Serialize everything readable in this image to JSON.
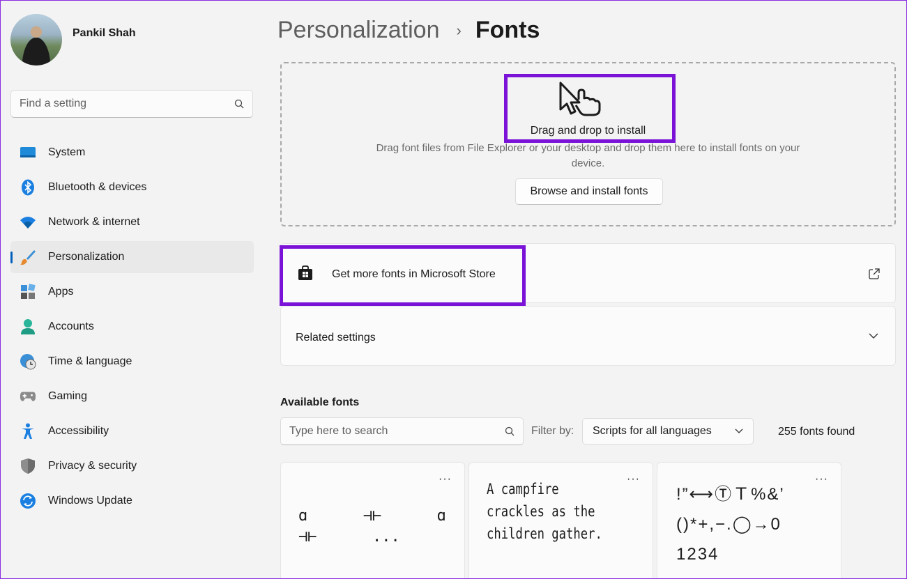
{
  "profile": {
    "name": "Pankil Shah"
  },
  "sidebar": {
    "search_placeholder": "Find a setting",
    "items": [
      {
        "label": "System",
        "icon": "system-icon"
      },
      {
        "label": "Bluetooth & devices",
        "icon": "bluetooth-icon"
      },
      {
        "label": "Network & internet",
        "icon": "wifi-icon"
      },
      {
        "label": "Personalization",
        "icon": "brush-icon",
        "active": true
      },
      {
        "label": "Apps",
        "icon": "apps-icon"
      },
      {
        "label": "Accounts",
        "icon": "accounts-icon"
      },
      {
        "label": "Time & language",
        "icon": "time-language-icon"
      },
      {
        "label": "Gaming",
        "icon": "gamepad-icon"
      },
      {
        "label": "Accessibility",
        "icon": "accessibility-icon"
      },
      {
        "label": "Privacy & security",
        "icon": "shield-icon"
      },
      {
        "label": "Windows Update",
        "icon": "update-icon"
      }
    ]
  },
  "breadcrumb": {
    "parent": "Personalization",
    "separator": "›",
    "current": "Fonts"
  },
  "dropzone": {
    "title": "Drag and drop to install",
    "description": "Drag font files from File Explorer or your desktop and drop them here to install fonts on your device.",
    "browse_button": "Browse and install fonts"
  },
  "store_card": {
    "label": "Get more fonts in Microsoft Store"
  },
  "related_card": {
    "label": "Related settings"
  },
  "available": {
    "title": "Available fonts",
    "search_placeholder": "Type here to search",
    "filter_label": "Filter by:",
    "filter_value": "Scripts for all languages",
    "count_text": "255 fonts found",
    "tiles": [
      {
        "more": "···",
        "sample_line1": "ɑ      ⊣⊢      ɑ",
        "sample_line2": "⊣⊢      ..."
      },
      {
        "more": "···",
        "sample": "A campfire crackles as the children gather."
      },
      {
        "more": "···",
        "sample_line1": "!”⟷ⓉＴ%&’",
        "sample_line2": "()*+,−.◯→0",
        "sample_line3": "1234"
      }
    ]
  },
  "colors": {
    "accent": "#005fb8",
    "highlight": "#7b12d8"
  }
}
